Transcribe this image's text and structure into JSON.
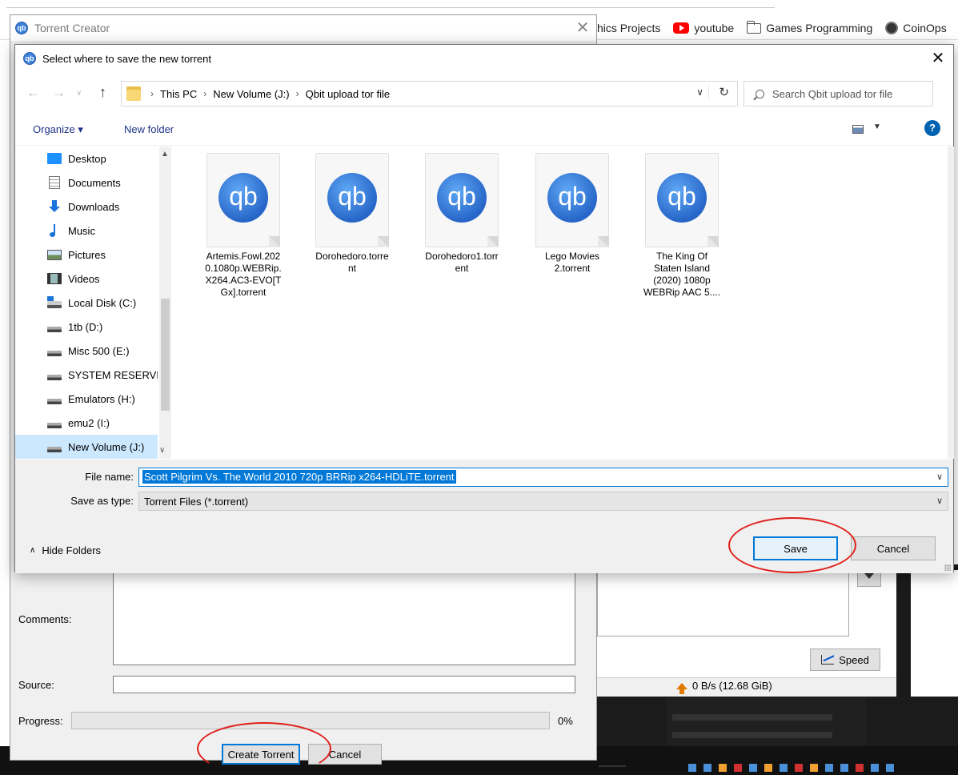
{
  "browser": {
    "bookmarks": [
      {
        "label": "hics Projects",
        "icon": "none"
      },
      {
        "label": "youtube",
        "icon": "youtube-icon"
      },
      {
        "label": "Games Programming",
        "icon": "folder-icon"
      },
      {
        "label": "CoinOps",
        "icon": "coinops-icon"
      }
    ]
  },
  "torrent_creator": {
    "title": "Torrent Creator",
    "comments_label": "Comments:",
    "source_label": "Source:",
    "progress_label": "Progress:",
    "progress_value": "0%",
    "progress_fraction": 0,
    "create_button": "Create Torrent",
    "cancel_button": "Cancel"
  },
  "background_app": {
    "speed_button": "Speed",
    "upload_speed": "0 B/s (12.68 GiB)"
  },
  "save_dialog": {
    "title": "Select where to save the new torrent",
    "breadcrumb": [
      "This PC",
      "New Volume (J:)",
      "Qbit upload tor file"
    ],
    "search_placeholder": "Search Qbit upload tor file",
    "toolbar": {
      "organize": "Organize ▾",
      "new_folder": "New folder"
    },
    "nav_items": [
      {
        "label": "Desktop",
        "icon": "desktop-icon"
      },
      {
        "label": "Documents",
        "icon": "documents-icon"
      },
      {
        "label": "Downloads",
        "icon": "downloads-icon"
      },
      {
        "label": "Music",
        "icon": "music-icon"
      },
      {
        "label": "Pictures",
        "icon": "pictures-icon"
      },
      {
        "label": "Videos",
        "icon": "videos-icon"
      },
      {
        "label": "Local Disk (C:)",
        "icon": "local-disk-icon"
      },
      {
        "label": "1tb (D:)",
        "icon": "drive-icon"
      },
      {
        "label": "Misc 500 (E:)",
        "icon": "drive-icon"
      },
      {
        "label": "SYSTEM RESERVI",
        "icon": "drive-icon"
      },
      {
        "label": "Emulators (H:)",
        "icon": "drive-icon"
      },
      {
        "label": "emu2 (I:)",
        "icon": "drive-icon"
      },
      {
        "label": "New Volume (J:)",
        "icon": "drive-icon",
        "selected": true
      }
    ],
    "files": [
      {
        "name": "Artemis.Fowl.202\n0.1080p.WEBRip.\nX264.AC3-EVO[T\nGx].torrent"
      },
      {
        "name": "Dorohedoro.torre\nnt"
      },
      {
        "name": "Dorohedoro1.torr\nent"
      },
      {
        "name": "Lego Movies\n2.torrent"
      },
      {
        "name": "The King Of\nStaten Island\n(2020) 1080p\nWEBRip AAC 5...."
      }
    ],
    "file_name_label": "File name:",
    "file_name_value": "Scott Pilgrim Vs. The World 2010 720p BRRip x264-HDLiTE.torrent",
    "save_type_label": "Save as type:",
    "save_type_value": "Torrent Files (*.torrent)",
    "hide_folders": "Hide Folders",
    "save_button": "Save",
    "cancel_button": "Cancel"
  },
  "colors": {
    "accent": "#0078d7",
    "annotation": "#e0201b",
    "qb_blue": "#3c7fd9"
  }
}
